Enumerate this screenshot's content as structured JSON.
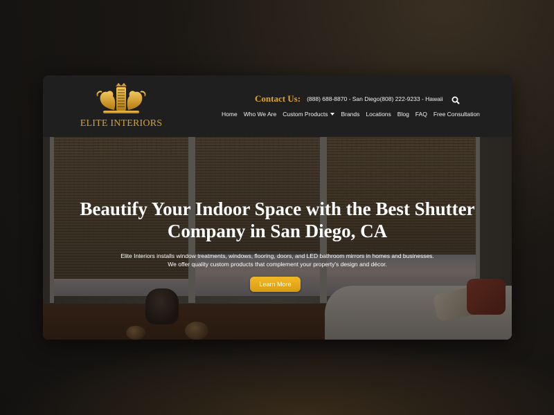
{
  "brand": {
    "logo_text": "ELITE INTERIORS",
    "accent_color": "#e0a526"
  },
  "header": {
    "contact_label": "Contact Us:",
    "contact_phones": "(888) 688-8870 - San Diego(808) 222-9233 - Hawaii",
    "search_icon": "search-icon"
  },
  "nav": {
    "items": [
      {
        "label": "Home"
      },
      {
        "label": "Who We Are"
      },
      {
        "label": "Custom Products",
        "has_dropdown": true
      },
      {
        "label": "Brands"
      },
      {
        "label": "Locations"
      },
      {
        "label": "Blog"
      },
      {
        "label": "FAQ"
      },
      {
        "label": "Free Consultation"
      }
    ]
  },
  "hero": {
    "title_line1": "Beautify Your Indoor Space with the Best Shutter",
    "title_line2": "Company in San Diego, CA",
    "desc_line1": "Elite Interiors installs window treatments, windows, flooring, doors, and LED bathroom mirrors in homes and businesses.",
    "desc_line2": "We offer quality custom products that complement your property's design and décor.",
    "cta_label": "Learn More",
    "cta_color": "#f0b020"
  }
}
